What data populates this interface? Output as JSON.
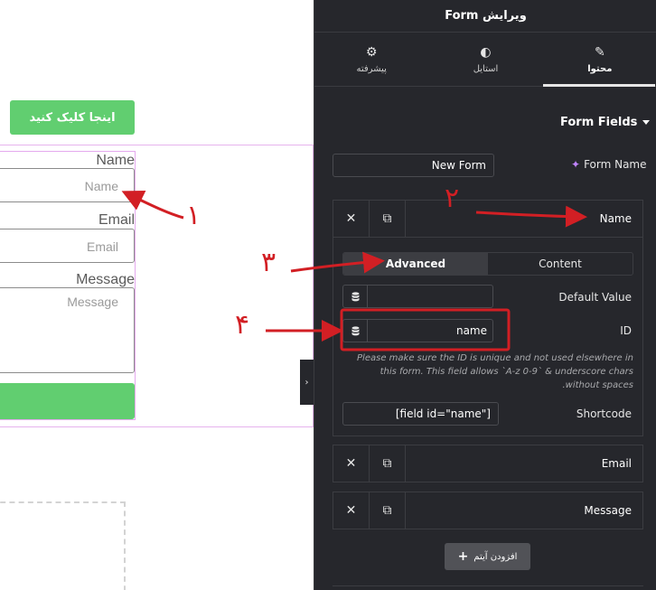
{
  "preview": {
    "click_button": "اینجا کلیک کنید",
    "fields": [
      {
        "label": "Name",
        "placeholder": "Name"
      },
      {
        "label": "Email",
        "placeholder": "Email"
      },
      {
        "label": "Message",
        "placeholder": "Message"
      }
    ]
  },
  "panel": {
    "title": "ویرایش Form",
    "tabs": [
      {
        "label": "پیشرفته",
        "icon": "gear-icon"
      },
      {
        "label": "استایل",
        "icon": "half-circle-icon"
      },
      {
        "label": "محتوا",
        "icon": "pencil-icon"
      }
    ],
    "active_tab": "محتوا",
    "section_title": "Form Fields",
    "form_name_label": "Form Name",
    "form_name_value": "New Form",
    "items": [
      {
        "title": "Name"
      },
      {
        "title": "Email"
      },
      {
        "title": "Message"
      }
    ],
    "sub_tabs": [
      "Advanced",
      "Content"
    ],
    "active_sub_tab": "Advanced",
    "default_value_label": "Default Value",
    "default_value": "",
    "id_label": "ID",
    "id_value": "name",
    "id_help": "Please make sure the ID is unique and not used elsewhere in this form. This field allows `A-z 0-9` & underscore chars without spaces.",
    "shortcode_label": "Shortcode",
    "shortcode_value": "[field id=\"name\"]",
    "add_item_label": "افزودن آیتم"
  },
  "annotations": [
    "۱",
    "۲",
    "۳",
    "۴"
  ],
  "colors": {
    "accent_green": "#61ce70",
    "panel_bg": "#26272c",
    "annotation_red": "#d21f24"
  }
}
